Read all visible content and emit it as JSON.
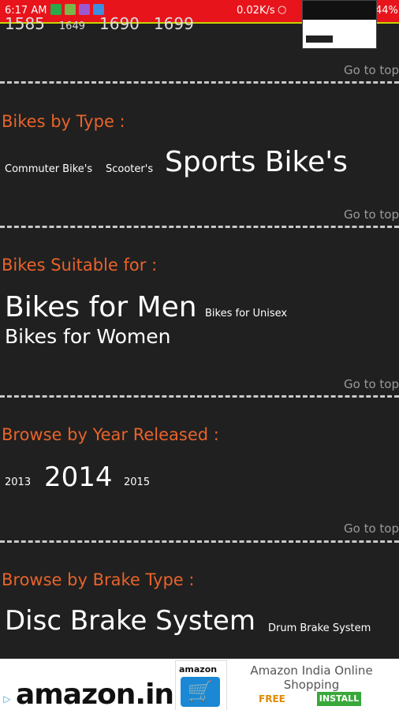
{
  "status_bar": {
    "time": "6:17 AM",
    "speed": "0.02K/s",
    "battery": "44%"
  },
  "top_partial_numbers": [
    "1585",
    "1649",
    "1690",
    "1699"
  ],
  "go_to_top": "Go to top",
  "sections": [
    {
      "heading": "Bikes by Type :",
      "tags": [
        "Commuter Bike's",
        "Scooter's",
        "Sports Bike's"
      ]
    },
    {
      "heading": "Bikes Suitable for :",
      "tags": [
        "Bikes for Men",
        "Bikes for Unisex",
        "Bikes for Women"
      ]
    },
    {
      "heading": "Browse by Year Released :",
      "tags": [
        "2013",
        "2014",
        "2015"
      ]
    },
    {
      "heading": "Browse by Brake Type :",
      "tags": [
        "Disc Brake System",
        "Drum Brake System"
      ]
    }
  ],
  "ad": {
    "brand": "amazon.in",
    "app_label": "amazon",
    "title": "Amazon India Online Shopping",
    "price": "FREE",
    "install_label": "INSTALL"
  },
  "colors": {
    "background": "#202020",
    "heading": "#e8632a",
    "status_bar": "#e8141b",
    "install": "#39a83a"
  }
}
